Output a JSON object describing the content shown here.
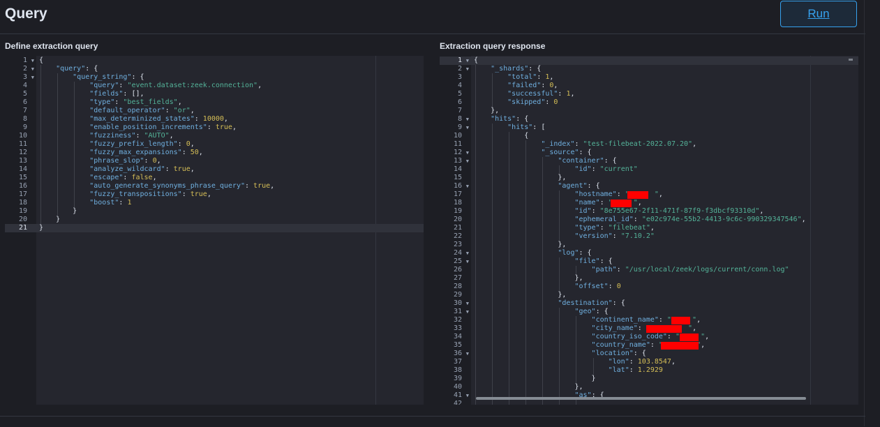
{
  "header": {
    "title": "Query",
    "run_label": "Run"
  },
  "query_panel": {
    "label": "Define extraction query",
    "active_line": 21,
    "fold_lines": [
      1,
      2,
      3
    ],
    "lines": [
      {
        "n": "1",
        "d": 0,
        "t": [
          [
            "p",
            "{"
          ]
        ]
      },
      {
        "n": "2",
        "d": 1,
        "t": [
          [
            "k",
            "\"query\""
          ],
          [
            "p",
            ": {"
          ]
        ]
      },
      {
        "n": "3",
        "d": 2,
        "t": [
          [
            "k",
            "\"query_string\""
          ],
          [
            "p",
            ": {"
          ]
        ]
      },
      {
        "n": "4",
        "d": 3,
        "t": [
          [
            "k",
            "\"query\""
          ],
          [
            "p",
            ": "
          ],
          [
            "s",
            "\"event.dataset:zeek.connection\""
          ],
          [
            "p",
            ","
          ]
        ]
      },
      {
        "n": "5",
        "d": 3,
        "t": [
          [
            "k",
            "\"fields\""
          ],
          [
            "p",
            ": [],"
          ]
        ]
      },
      {
        "n": "6",
        "d": 3,
        "t": [
          [
            "k",
            "\"type\""
          ],
          [
            "p",
            ": "
          ],
          [
            "s",
            "\"best_fields\""
          ],
          [
            "p",
            ","
          ]
        ]
      },
      {
        "n": "7",
        "d": 3,
        "t": [
          [
            "k",
            "\"default_operator\""
          ],
          [
            "p",
            ": "
          ],
          [
            "s",
            "\"or\""
          ],
          [
            "p",
            ","
          ]
        ]
      },
      {
        "n": "8",
        "d": 3,
        "t": [
          [
            "k",
            "\"max_determinized_states\""
          ],
          [
            "p",
            ": "
          ],
          [
            "n",
            "10000"
          ],
          [
            "p",
            ","
          ]
        ]
      },
      {
        "n": "9",
        "d": 3,
        "t": [
          [
            "k",
            "\"enable_position_increments\""
          ],
          [
            "p",
            ": "
          ],
          [
            "n",
            "true"
          ],
          [
            "p",
            ","
          ]
        ]
      },
      {
        "n": "10",
        "d": 3,
        "t": [
          [
            "k",
            "\"fuzziness\""
          ],
          [
            "p",
            ": "
          ],
          [
            "s",
            "\"AUTO\""
          ],
          [
            "p",
            ","
          ]
        ]
      },
      {
        "n": "11",
        "d": 3,
        "t": [
          [
            "k",
            "\"fuzzy_prefix_length\""
          ],
          [
            "p",
            ": "
          ],
          [
            "n",
            "0"
          ],
          [
            "p",
            ","
          ]
        ]
      },
      {
        "n": "12",
        "d": 3,
        "t": [
          [
            "k",
            "\"fuzzy_max_expansions\""
          ],
          [
            "p",
            ": "
          ],
          [
            "n",
            "50"
          ],
          [
            "p",
            ","
          ]
        ]
      },
      {
        "n": "13",
        "d": 3,
        "t": [
          [
            "k",
            "\"phrase_slop\""
          ],
          [
            "p",
            ": "
          ],
          [
            "n",
            "0"
          ],
          [
            "p",
            ","
          ]
        ]
      },
      {
        "n": "14",
        "d": 3,
        "t": [
          [
            "k",
            "\"analyze_wildcard\""
          ],
          [
            "p",
            ": "
          ],
          [
            "n",
            "true"
          ],
          [
            "p",
            ","
          ]
        ]
      },
      {
        "n": "15",
        "d": 3,
        "t": [
          [
            "k",
            "\"escape\""
          ],
          [
            "p",
            ": "
          ],
          [
            "n",
            "false"
          ],
          [
            "p",
            ","
          ]
        ]
      },
      {
        "n": "16",
        "d": 3,
        "t": [
          [
            "k",
            "\"auto_generate_synonyms_phrase_query\""
          ],
          [
            "p",
            ": "
          ],
          [
            "n",
            "true"
          ],
          [
            "p",
            ","
          ]
        ]
      },
      {
        "n": "17",
        "d": 3,
        "t": [
          [
            "k",
            "\"fuzzy_transpositions\""
          ],
          [
            "p",
            ": "
          ],
          [
            "n",
            "true"
          ],
          [
            "p",
            ","
          ]
        ]
      },
      {
        "n": "18",
        "d": 3,
        "t": [
          [
            "k",
            "\"boost\""
          ],
          [
            "p",
            ": "
          ],
          [
            "n",
            "1"
          ]
        ]
      },
      {
        "n": "19",
        "d": 2,
        "t": [
          [
            "p",
            "}"
          ]
        ]
      },
      {
        "n": "20",
        "d": 1,
        "t": [
          [
            "p",
            "}"
          ]
        ]
      },
      {
        "n": "21",
        "d": 0,
        "t": [
          [
            "p",
            "}"
          ]
        ]
      }
    ]
  },
  "response_panel": {
    "label": "Extraction query response",
    "active_line": 1,
    "fold_lines": [
      1,
      2,
      8,
      9,
      12,
      13,
      16,
      24,
      25,
      30,
      31,
      36,
      41
    ],
    "lines": [
      {
        "n": "1",
        "d": 0,
        "t": [
          [
            "p",
            "{"
          ]
        ]
      },
      {
        "n": "2",
        "d": 1,
        "t": [
          [
            "k",
            "\"_shards\""
          ],
          [
            "p",
            ": {"
          ]
        ]
      },
      {
        "n": "3",
        "d": 2,
        "t": [
          [
            "k",
            "\"total\""
          ],
          [
            "p",
            ": "
          ],
          [
            "n",
            "1"
          ],
          [
            "p",
            ","
          ]
        ]
      },
      {
        "n": "4",
        "d": 2,
        "t": [
          [
            "k",
            "\"failed\""
          ],
          [
            "p",
            ": "
          ],
          [
            "n",
            "0"
          ],
          [
            "p",
            ","
          ]
        ]
      },
      {
        "n": "5",
        "d": 2,
        "t": [
          [
            "k",
            "\"successful\""
          ],
          [
            "p",
            ": "
          ],
          [
            "n",
            "1"
          ],
          [
            "p",
            ","
          ]
        ]
      },
      {
        "n": "6",
        "d": 2,
        "t": [
          [
            "k",
            "\"skipped\""
          ],
          [
            "p",
            ": "
          ],
          [
            "n",
            "0"
          ]
        ]
      },
      {
        "n": "7",
        "d": 1,
        "t": [
          [
            "p",
            "},"
          ]
        ]
      },
      {
        "n": "8",
        "d": 1,
        "t": [
          [
            "k",
            "\"hits\""
          ],
          [
            "p",
            ": {"
          ]
        ]
      },
      {
        "n": "9",
        "d": 2,
        "t": [
          [
            "k",
            "\"hits\""
          ],
          [
            "p",
            ": ["
          ]
        ]
      },
      {
        "n": "10",
        "d": 3,
        "t": [
          [
            "p",
            "{"
          ]
        ]
      },
      {
        "n": "11",
        "d": 4,
        "t": [
          [
            "k",
            "\"_index\""
          ],
          [
            "p",
            ": "
          ],
          [
            "s",
            "\"test-filebeat-2022.07.20\""
          ],
          [
            "p",
            ","
          ]
        ]
      },
      {
        "n": "12",
        "d": 4,
        "t": [
          [
            "k",
            "\"_source\""
          ],
          [
            "p",
            ": {"
          ]
        ]
      },
      {
        "n": "13",
        "d": 5,
        "t": [
          [
            "k",
            "\"container\""
          ],
          [
            "p",
            ": {"
          ]
        ]
      },
      {
        "n": "14",
        "d": 6,
        "t": [
          [
            "k",
            "\"id\""
          ],
          [
            "p",
            ": "
          ],
          [
            "s",
            "\"current\""
          ]
        ]
      },
      {
        "n": "15",
        "d": 5,
        "t": [
          [
            "p",
            "},"
          ]
        ]
      },
      {
        "n": "16",
        "d": 5,
        "t": [
          [
            "k",
            "\"agent\""
          ],
          [
            "p",
            ": {"
          ]
        ]
      },
      {
        "n": "17",
        "d": 6,
        "t": [
          [
            "k",
            "\"hostname\""
          ],
          [
            "p",
            ": "
          ],
          [
            "s",
            "\"      \""
          ],
          [
            "p",
            ","
          ]
        ],
        "r": [
          12.5,
          5
        ]
      },
      {
        "n": "18",
        "d": 6,
        "t": [
          [
            "k",
            "\"name\""
          ],
          [
            "p",
            ": "
          ],
          [
            "s",
            "\"     \""
          ],
          [
            "p",
            ","
          ]
        ],
        "r": [
          8.5,
          5
        ]
      },
      {
        "n": "19",
        "d": 6,
        "t": [
          [
            "k",
            "\"id\""
          ],
          [
            "p",
            ": "
          ],
          [
            "s",
            "\"8e755e67-2f11-471f-87f9-f3dbcf93310d\""
          ],
          [
            "p",
            ","
          ]
        ]
      },
      {
        "n": "20",
        "d": 6,
        "t": [
          [
            "k",
            "\"ephemeral_id\""
          ],
          [
            "p",
            ": "
          ],
          [
            "s",
            "\"e02c974e-55b2-4413-9c6c-990329347546\""
          ],
          [
            "p",
            ","
          ]
        ]
      },
      {
        "n": "21",
        "d": 6,
        "t": [
          [
            "k",
            "\"type\""
          ],
          [
            "p",
            ": "
          ],
          [
            "s",
            "\"filebeat\""
          ],
          [
            "p",
            ","
          ]
        ]
      },
      {
        "n": "22",
        "d": 6,
        "t": [
          [
            "k",
            "\"version\""
          ],
          [
            "p",
            ": "
          ],
          [
            "s",
            "\"7.10.2\""
          ]
        ]
      },
      {
        "n": "23",
        "d": 5,
        "t": [
          [
            "p",
            "},"
          ]
        ]
      },
      {
        "n": "24",
        "d": 5,
        "t": [
          [
            "k",
            "\"log\""
          ],
          [
            "p",
            ": {"
          ]
        ]
      },
      {
        "n": "25",
        "d": 6,
        "t": [
          [
            "k",
            "\"file\""
          ],
          [
            "p",
            ": {"
          ]
        ]
      },
      {
        "n": "26",
        "d": 7,
        "t": [
          [
            "k",
            "\"path\""
          ],
          [
            "p",
            ": "
          ],
          [
            "s",
            "\"/usr/local/zeek/logs/current/conn.log\""
          ]
        ]
      },
      {
        "n": "27",
        "d": 6,
        "t": [
          [
            "p",
            "},"
          ]
        ]
      },
      {
        "n": "28",
        "d": 6,
        "t": [
          [
            "k",
            "\"offset\""
          ],
          [
            "p",
            ": "
          ],
          [
            "n",
            "0"
          ]
        ]
      },
      {
        "n": "29",
        "d": 5,
        "t": [
          [
            "p",
            "},"
          ]
        ]
      },
      {
        "n": "30",
        "d": 5,
        "t": [
          [
            "k",
            "\"destination\""
          ],
          [
            "p",
            ": {"
          ]
        ]
      },
      {
        "n": "31",
        "d": 6,
        "t": [
          [
            "k",
            "\"geo\""
          ],
          [
            "p",
            ": {"
          ]
        ]
      },
      {
        "n": "32",
        "d": 7,
        "t": [
          [
            "k",
            "\"continent_name\""
          ],
          [
            "p",
            ": "
          ],
          [
            "s",
            "\"     \""
          ],
          [
            "p",
            ","
          ]
        ],
        "r": [
          19,
          4.5
        ]
      },
      {
        "n": "33",
        "d": 7,
        "t": [
          [
            "k",
            "\"city_name\""
          ],
          [
            "p",
            ": "
          ],
          [
            "s",
            "\"         \""
          ],
          [
            "p",
            ","
          ]
        ],
        "r": [
          13,
          8.5
        ]
      },
      {
        "n": "34",
        "d": 7,
        "t": [
          [
            "k",
            "\"country_iso_code\""
          ],
          [
            "p",
            ": "
          ],
          [
            "s",
            "\"     \""
          ],
          [
            "p",
            ","
          ]
        ],
        "r": [
          21,
          4.5
        ]
      },
      {
        "n": "35",
        "d": 7,
        "t": [
          [
            "k",
            "\"country_name\""
          ],
          [
            "p",
            ": "
          ],
          [
            "s",
            "\"        \""
          ],
          [
            "p",
            ","
          ]
        ],
        "r": [
          16.5,
          9
        ]
      },
      {
        "n": "36",
        "d": 7,
        "t": [
          [
            "k",
            "\"location\""
          ],
          [
            "p",
            ": {"
          ]
        ]
      },
      {
        "n": "37",
        "d": 8,
        "t": [
          [
            "k",
            "\"lon\""
          ],
          [
            "p",
            ": "
          ],
          [
            "n",
            "103.8547"
          ],
          [
            "p",
            ","
          ]
        ]
      },
      {
        "n": "38",
        "d": 8,
        "t": [
          [
            "k",
            "\"lat\""
          ],
          [
            "p",
            ": "
          ],
          [
            "n",
            "1.2929"
          ]
        ]
      },
      {
        "n": "39",
        "d": 7,
        "t": [
          [
            "p",
            "}"
          ]
        ]
      },
      {
        "n": "40",
        "d": 6,
        "t": [
          [
            "p",
            "},"
          ]
        ]
      },
      {
        "n": "41",
        "d": 6,
        "t": [
          [
            "k",
            "\"as\""
          ],
          [
            "p",
            ": {"
          ]
        ]
      },
      {
        "n": "42",
        "d": 7,
        "t": []
      }
    ]
  }
}
